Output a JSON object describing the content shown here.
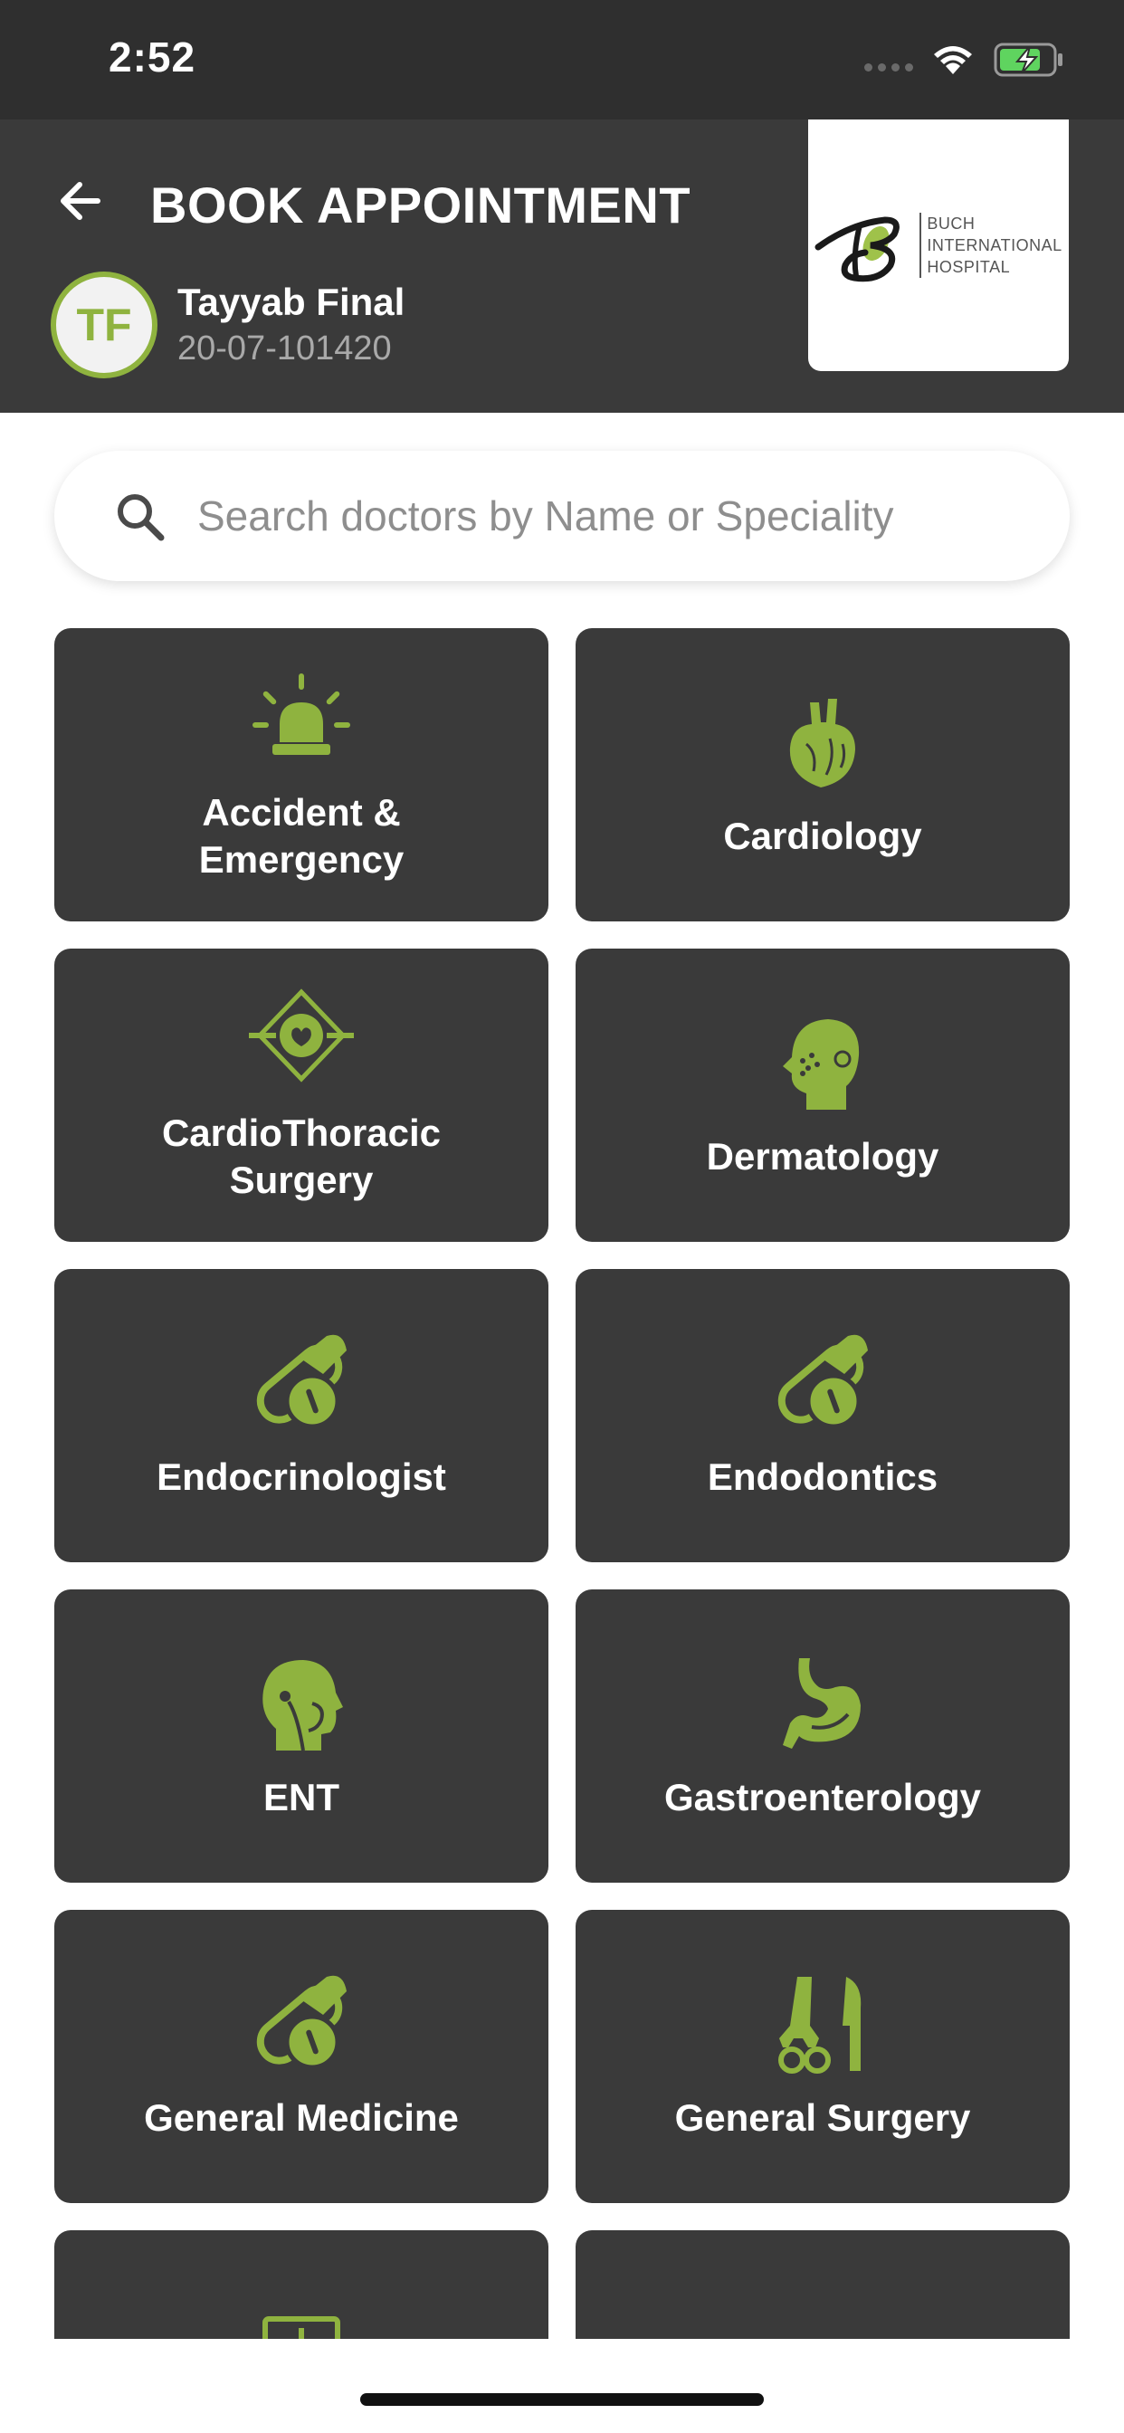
{
  "status_bar": {
    "time": "2:52"
  },
  "header": {
    "title": "BOOK APPOINTMENT",
    "avatar_initials": "TF",
    "user_name": "Tayyab Final",
    "user_id": "20-07-101420",
    "logo_lines": [
      "BUCH",
      "INTERNATIONAL",
      "HOSPITAL"
    ]
  },
  "search": {
    "placeholder": "Search doctors by Name or Speciality"
  },
  "colors": {
    "accent": "#8fb33f",
    "card_bg": "#3a3a3a",
    "header_bg": "#3a3a3a"
  },
  "specialities": [
    {
      "label": "Accident & Emergency",
      "icon": "siren-icon"
    },
    {
      "label": "Cardiology",
      "icon": "heart-icon"
    },
    {
      "label": "CardioThoracic Surgery",
      "icon": "heart-surgery-icon"
    },
    {
      "label": "Dermatology",
      "icon": "face-skin-icon"
    },
    {
      "label": "Endocrinologist",
      "icon": "pill-icon"
    },
    {
      "label": "Endodontics",
      "icon": "pill-icon"
    },
    {
      "label": "ENT",
      "icon": "head-throat-icon"
    },
    {
      "label": "Gastroenterology",
      "icon": "stomach-icon"
    },
    {
      "label": "General Medicine",
      "icon": "pill-icon"
    },
    {
      "label": "General Surgery",
      "icon": "surgery-tools-icon"
    },
    {
      "label": "",
      "icon": "xray-icon"
    },
    {
      "label": "",
      "icon": "kidney-icon"
    }
  ]
}
